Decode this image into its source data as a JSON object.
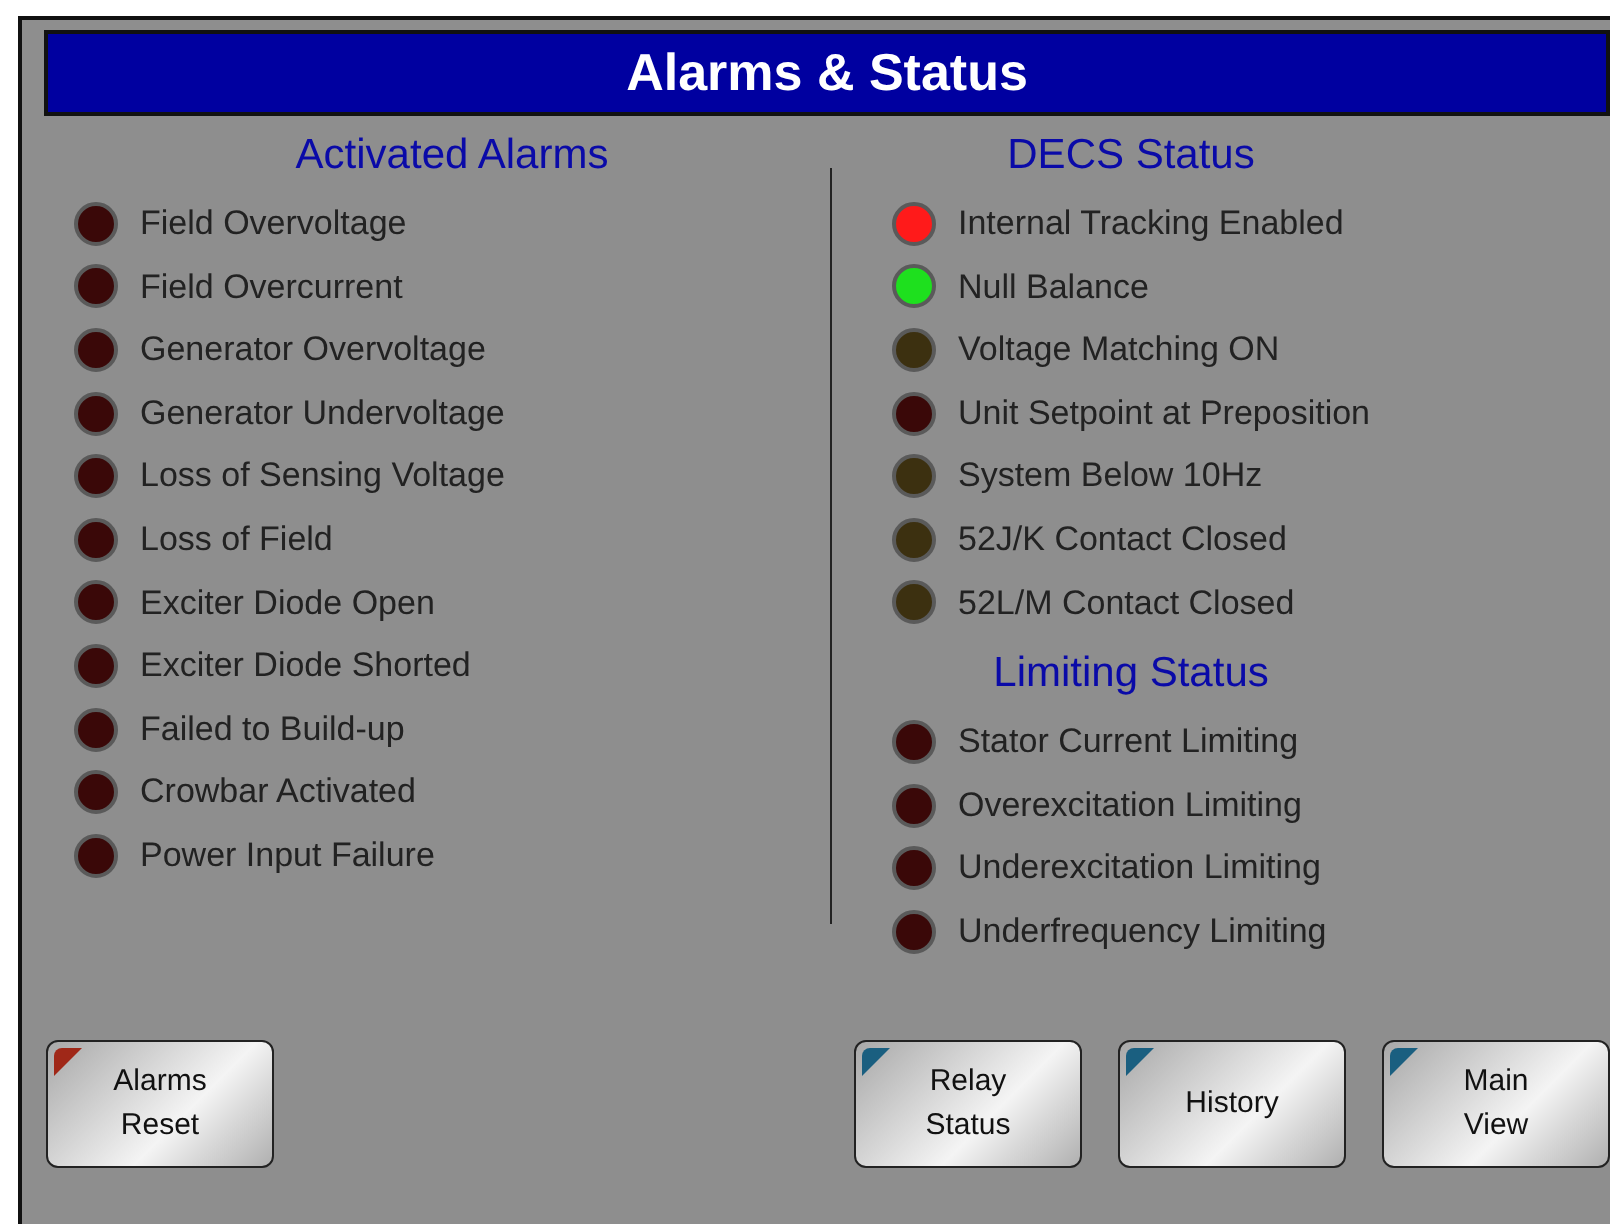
{
  "title": "Alarms & Status",
  "activated_alarms": {
    "heading": "Activated Alarms",
    "items": [
      {
        "label": "Field Overvoltage",
        "color": "#3a0808"
      },
      {
        "label": "Field Overcurrent",
        "color": "#3a0808"
      },
      {
        "label": "Generator Overvoltage",
        "color": "#3a0808"
      },
      {
        "label": "Generator Undervoltage",
        "color": "#3a0808"
      },
      {
        "label": "Loss of Sensing Voltage",
        "color": "#3a0808"
      },
      {
        "label": "Loss of Field",
        "color": "#3a0808"
      },
      {
        "label": "Exciter Diode Open",
        "color": "#3a0808"
      },
      {
        "label": "Exciter Diode Shorted",
        "color": "#3a0808"
      },
      {
        "label": "Failed to Build-up",
        "color": "#3a0808"
      },
      {
        "label": "Crowbar Activated",
        "color": "#3a0808"
      },
      {
        "label": "Power Input Failure",
        "color": "#3a0808"
      }
    ]
  },
  "decs_status": {
    "heading": "DECS Status",
    "items": [
      {
        "label": "Internal Tracking Enabled",
        "color": "#ff1a1a"
      },
      {
        "label": "Null Balance",
        "color": "#1ee01e"
      },
      {
        "label": "Voltage Matching ON",
        "color": "#3c3010"
      },
      {
        "label": "Unit Setpoint at Preposition",
        "color": "#3a0808"
      },
      {
        "label": "System Below 10Hz",
        "color": "#3c3010"
      },
      {
        "label": "52J/K Contact Closed",
        "color": "#3c3010"
      },
      {
        "label": "52L/M Contact Closed",
        "color": "#3c3010"
      }
    ]
  },
  "limiting_status": {
    "heading": "Limiting Status",
    "items": [
      {
        "label": "Stator Current Limiting",
        "color": "#3a0808"
      },
      {
        "label": "Overexcitation Limiting",
        "color": "#3a0808"
      },
      {
        "label": "Underexcitation Limiting",
        "color": "#3a0808"
      },
      {
        "label": "Underfrequency Limiting",
        "color": "#3a0808"
      }
    ]
  },
  "left_buttons": [
    {
      "lines": [
        "Alarms",
        "Reset"
      ],
      "color": "#a02818"
    }
  ],
  "right_buttons": [
    {
      "lines": [
        "Relay",
        "Status"
      ],
      "color": "#1a5f80"
    },
    {
      "lines": [
        "History"
      ],
      "color": "#1a5f80"
    },
    {
      "lines": [
        "Main",
        "View"
      ],
      "color": "#1a5f80"
    }
  ]
}
